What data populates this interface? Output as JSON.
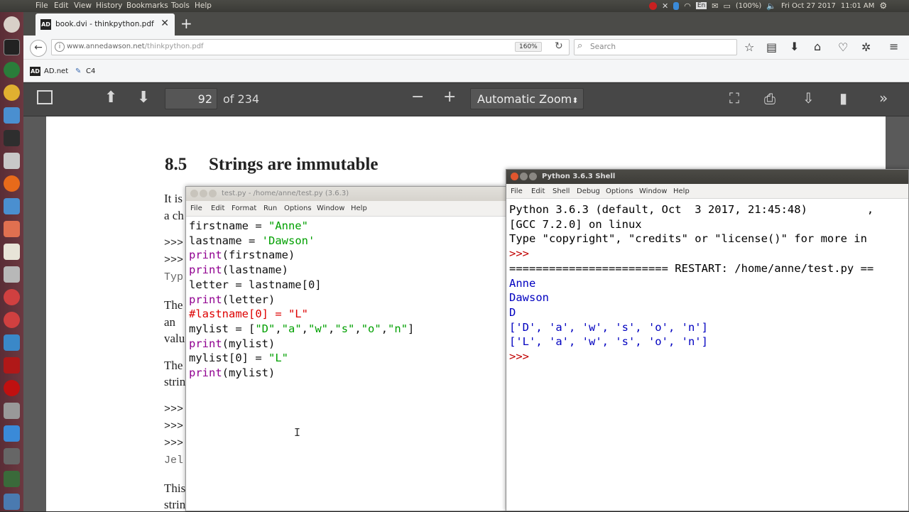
{
  "topbar": {
    "menus": [
      "File",
      "Edit",
      "View",
      "History",
      "Bookmarks",
      "Tools",
      "Help"
    ],
    "lang": "En",
    "battery": "(100%)",
    "datetime": "Fri Oct 27 2017",
    "time": "11:01 AM"
  },
  "browser": {
    "tab_title": "book.dvi - thinkpython.pdf",
    "tab_favicon": "AD",
    "url_host": "www.annedawson.net",
    "url_path": "/thinkpython.pdf",
    "zoom": "160%",
    "search_placeholder": "Search",
    "bookmarks": [
      {
        "label": "AD.net",
        "icon": "AD"
      },
      {
        "label": "C4",
        "icon": "c4-icon"
      }
    ]
  },
  "pdf": {
    "page_number": "92",
    "page_count": "of 234",
    "zoom_select": "Automatic Zoom",
    "section_number": "8.5",
    "section_title": "Strings are immutable",
    "fragments": [
      "It is",
      "a ch",
      ">>>",
      ">>>",
      "Typ",
      "The",
      "an",
      "valu",
      "The",
      "strin",
      ">>>",
      ">>>",
      ">>>",
      "Jel",
      "This",
      "strin"
    ]
  },
  "editor": {
    "title": "test.py - /home/anne/test.py (3.6.3)",
    "menus": [
      "File",
      "Edit",
      "Format",
      "Run",
      "Options",
      "Window",
      "Help"
    ],
    "lines": [
      [
        {
          "t": "firstname = ",
          "c": "nm"
        },
        {
          "t": "\"Anne\"",
          "c": "str"
        }
      ],
      [
        {
          "t": "lastname = ",
          "c": "nm"
        },
        {
          "t": "'Dawson'",
          "c": "str"
        }
      ],
      [
        {
          "t": "print",
          "c": "kw"
        },
        {
          "t": "(firstname)",
          "c": "nm"
        }
      ],
      [
        {
          "t": "print",
          "c": "kw"
        },
        {
          "t": "(lastname)",
          "c": "nm"
        }
      ],
      [
        {
          "t": "letter = lastname[0]",
          "c": "nm"
        }
      ],
      [
        {
          "t": "print",
          "c": "kw"
        },
        {
          "t": "(letter)",
          "c": "nm"
        }
      ],
      [
        {
          "t": "#lastname[0] = \"L\"",
          "c": "cm"
        }
      ],
      [
        {
          "t": "mylist = [",
          "c": "nm"
        },
        {
          "t": "\"D\"",
          "c": "str"
        },
        {
          "t": ",",
          "c": "nm"
        },
        {
          "t": "\"a\"",
          "c": "str"
        },
        {
          "t": ",",
          "c": "nm"
        },
        {
          "t": "\"w\"",
          "c": "str"
        },
        {
          "t": ",",
          "c": "nm"
        },
        {
          "t": "\"s\"",
          "c": "str"
        },
        {
          "t": ",",
          "c": "nm"
        },
        {
          "t": "\"o\"",
          "c": "str"
        },
        {
          "t": ",",
          "c": "nm"
        },
        {
          "t": "\"n\"",
          "c": "str"
        },
        {
          "t": "]",
          "c": "nm"
        }
      ],
      [
        {
          "t": "print",
          "c": "kw"
        },
        {
          "t": "(mylist)",
          "c": "nm"
        }
      ],
      [
        {
          "t": "mylist[0] = ",
          "c": "nm"
        },
        {
          "t": "\"L\"",
          "c": "str"
        }
      ],
      [
        {
          "t": "print",
          "c": "kw"
        },
        {
          "t": "(mylist)",
          "c": "nm"
        }
      ]
    ]
  },
  "shell": {
    "title": "Python 3.6.3 Shell",
    "menus": [
      "File",
      "Edit",
      "Shell",
      "Debug",
      "Options",
      "Window",
      "Help"
    ],
    "lines": [
      {
        "t": "Python 3.6.3 (default, Oct  3 2017, 21:45:48)         ,",
        "c": "out"
      },
      {
        "t": "[GCC 7.2.0] on linux",
        "c": "out"
      },
      {
        "t": "Type \"copyright\", \"credits\" or \"license()\" for more in",
        "c": "out"
      },
      {
        "t": ">>> ",
        "c": "prompt"
      },
      {
        "t": "======================== RESTART: /home/anne/test.py ==",
        "c": "out"
      },
      {
        "t": "Anne",
        "c": "blue"
      },
      {
        "t": "Dawson",
        "c": "blue"
      },
      {
        "t": "D",
        "c": "blue"
      },
      {
        "t": "['D', 'a', 'w', 's', 'o', 'n']",
        "c": "blue"
      },
      {
        "t": "['L', 'a', 'w', 's', 'o', 'n']",
        "c": "blue"
      },
      {
        "t": ">>> ",
        "c": "prompt"
      }
    ]
  },
  "colors": {
    "keyword": "#900090",
    "string": "#00a000",
    "comment": "#dd0000",
    "output": "#0000c0",
    "prompt": "#c00000"
  }
}
